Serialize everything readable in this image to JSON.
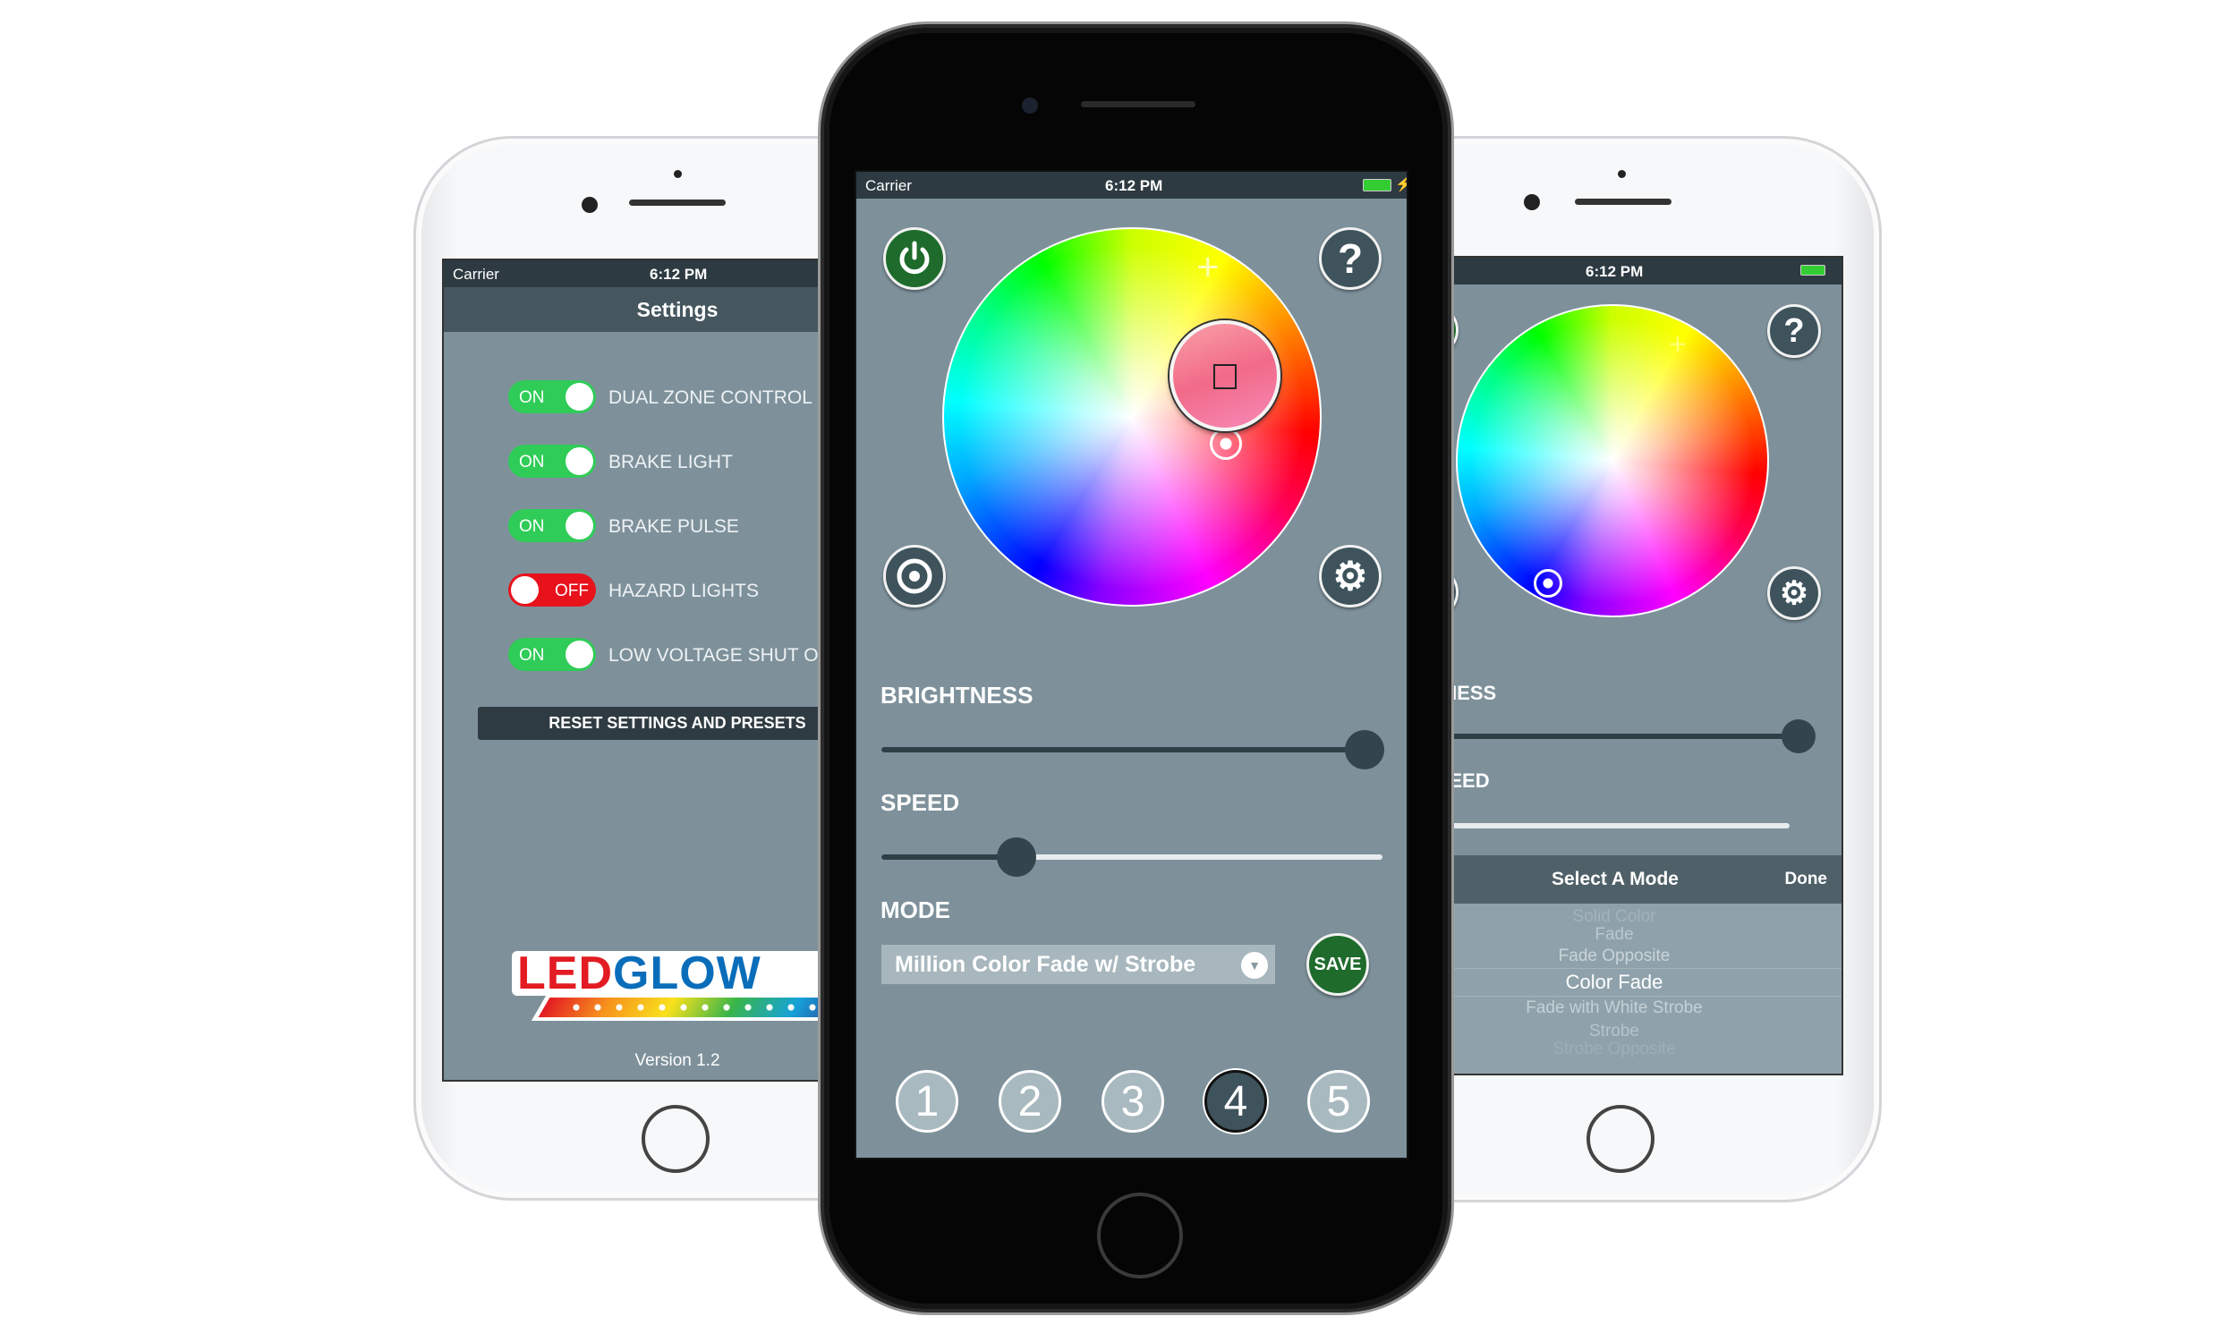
{
  "colors": {
    "accent_green": "#1e6b2c",
    "toggle_on": "#2fcc57",
    "toggle_off": "#e8121c",
    "screen_bg": "#7e919b",
    "header_bg": "#45565f"
  },
  "left_phone": {
    "status": {
      "carrier": "Carrier",
      "time": "6:12 PM"
    },
    "header_title": "Settings",
    "toggles": [
      {
        "label": "DUAL ZONE CONTROL",
        "state": "ON"
      },
      {
        "label": "BRAKE LIGHT",
        "state": "ON"
      },
      {
        "label": "BRAKE PULSE",
        "state": "ON"
      },
      {
        "label": "HAZARD LIGHTS",
        "state": "OFF"
      },
      {
        "label": "LOW VOLTAGE SHUT OFF",
        "state": "ON"
      }
    ],
    "reset_button": "RESET SETTINGS AND PRESETS",
    "logo_text": "LEDGLOW",
    "version": "Version 1.2"
  },
  "center_phone": {
    "status": {
      "carrier": "Carrier",
      "time": "6:12 PM"
    },
    "icons": {
      "power": "power-icon",
      "help": "question-icon",
      "target": "target-icon",
      "settings": "gear-icon"
    },
    "help_glyph": "?",
    "brightness_label": "BRIGHTNESS",
    "brightness_value": 1.0,
    "speed_label": "SPEED",
    "speed_value": 0.27,
    "mode_label": "MODE",
    "mode_selected": "Million Color Fade w/ Strobe",
    "save_label": "SAVE",
    "presets": [
      "1",
      "2",
      "3",
      "4",
      "5"
    ],
    "selected_preset": "4"
  },
  "right_phone": {
    "status": {
      "time": "6:12 PM"
    },
    "help_glyph": "?",
    "brightness_label": "BRIGHTNESS",
    "brightness_value": 0.98,
    "speed_label": "SPEED",
    "speed_value": 0.1,
    "picker_title": "Select A Mode",
    "picker_done": "Done",
    "picker_items": [
      "Solid Color",
      "Fade",
      "Fade Opposite",
      "Color Fade",
      "Fade with White Strobe",
      "Strobe",
      "Strobe Opposite"
    ],
    "picker_selected": "Color Fade"
  }
}
